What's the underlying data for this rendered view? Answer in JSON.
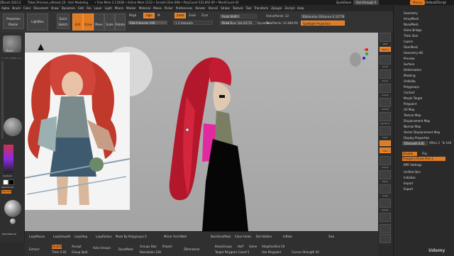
{
  "titlebar": {
    "items": [
      "ZBrush 2023.2",
      "Tribal_Princess_ulthead_10 - Hair Modeling",
      "• Free Mem 2.116GB • Active Mem 1133 • Scratch Disk 898 • PolyCount 525.892 KP • MeshCount 43"
    ],
    "quicksave": "QuickSave",
    "seethrough": "See-through 0",
    "menus": "Menus",
    "script": "DefaultZScript"
  },
  "menubar": [
    "Alpha",
    "Brush",
    "Color",
    "Document",
    "Draw",
    "Dynamics",
    "Edit",
    "File",
    "Layer",
    "Light",
    "Macro",
    "Marker",
    "Material",
    "Movie",
    "Picker",
    "Preferences",
    "Render",
    "Stencil",
    "Stroke",
    "Texture",
    "Tool",
    "Transform",
    "Zplugin",
    "Zscript",
    "Help"
  ],
  "shelf": {
    "projection_master": "Projection Master",
    "lightbox": "LightBox",
    "quick_sketch": "Quick Sketch",
    "edit": "Edit",
    "draw": "Draw",
    "move": "Move",
    "scale": "Scale",
    "rotate": "Rotate",
    "mrgb": "Mrgb",
    "rgb": "Rgb",
    "m": "M",
    "rgb_intensity": "Rgb Intensity 100",
    "zadd": "Zadd",
    "zsub": "Zsub",
    "zcut": "Zcut",
    "z_intensity": "Z Intensity",
    "z_intensity_value": "1",
    "focal_shift": "Focal Shift 0",
    "draw_size": "Draw Size 324.83731",
    "dynamic": "Dynamic",
    "active_points": "ActivePoints: 22",
    "total_points": "TotalPoints: 22.848 Mil",
    "calibration": "Calibration Distance 0.10778",
    "spotlight": "Spotlight Projection"
  },
  "lefttray": {
    "brush_label": "Move",
    "gradient": "Gradient",
    "switch_color": "SwitchColor",
    "alternate": "Alternate",
    "basic_material": "BasicMaterial",
    "dims": "1 * 27 x 3368 x 1.1"
  },
  "righttools": [
    "BPR",
    "SPix 3",
    "Scroll",
    "Zoom",
    "Actual",
    "AAHalf",
    "Dynamic",
    "Persp",
    "Floor",
    "L.Sym",
    "Xyz",
    "Frame",
    "Move",
    "Scale",
    "Rotate",
    "Line Fill",
    "Transp",
    "Ghost",
    "Solo",
    "Xpose"
  ],
  "palette": {
    "items": [
      "Geometry",
      "ArrayMesh",
      "NanoMesh",
      "Slime Bridge",
      "Thick Skin",
      "Layers",
      "FiberMesh",
      "Geometry HD",
      "Preview",
      "Surface",
      "Deformation",
      "Masking",
      "Visibility",
      "Polygroups",
      "Contact",
      "Morph Target",
      "Polypaint",
      "UV Map",
      "Texture Map",
      "Displacement Map",
      "Normal Map",
      "Vector Displacement Map",
      "Display Properties"
    ],
    "dsmooth": "DSmooth 0.85",
    "bpr_label": "BPR",
    "double": "Double",
    "flip": "Flip",
    "poly_draw_size": "Polygons Draw Size 1",
    "bpr_settings": "BPR Settings",
    "bottom_items": [
      "Unified Skin",
      "Initialize",
      "Import",
      "Export"
    ],
    "dsmooth2": "Xfiles 3",
    "to": "To 100"
  },
  "bottom": {
    "row1": [
      "LazyMouse",
      "LazySmooth",
      "LazyStep",
      "LazyRadius",
      "BackTrack",
      "Mask By Polygroups 0",
      "Mirror And Weld",
      "BackfaceMask",
      "Close Holes",
      "Del Hidden",
      "Inflate",
      "Size"
    ],
    "row2": [
      "Extract",
      "Double",
      "Thick 0.02",
      "Accept",
      "Group Split",
      "Auto Groups",
      "DynaMesh",
      "Groups",
      "Blur",
      "Project",
      "Resolution 128",
      "ZRemesher",
      "KeepGroups",
      "Half",
      "Same",
      "AdaptiveSize 50",
      "Use Polypaint",
      "Curves Strength 50",
      "Target Polygons Count 5"
    ]
  },
  "watermark": "Udemy"
}
